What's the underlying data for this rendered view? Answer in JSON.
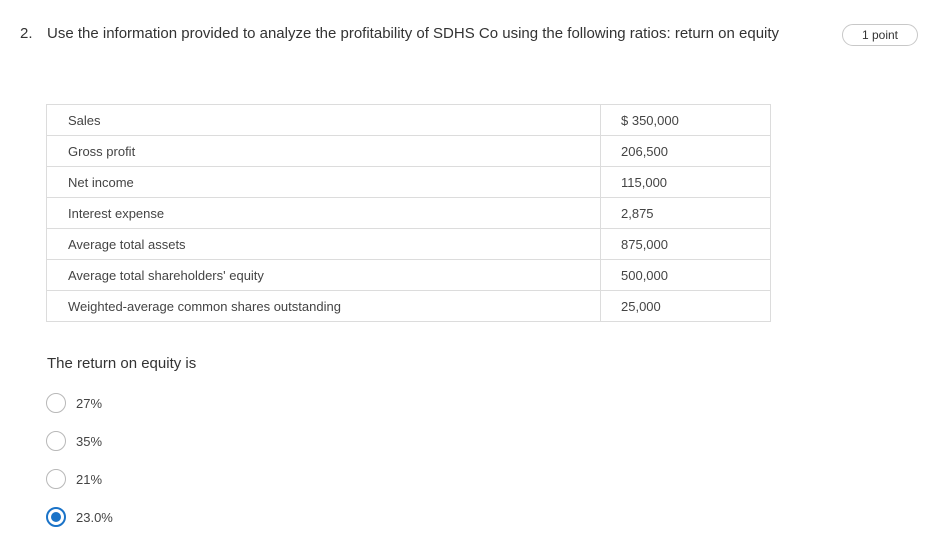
{
  "question": {
    "number": "2.",
    "text": "Use the information provided to analyze the profitability of SDHS Co using the following ratios: return on equity",
    "points": "1 point"
  },
  "table": {
    "rows": [
      {
        "label": "Sales",
        "value": "$ 350,000"
      },
      {
        "label": "Gross profit",
        "value": "206,500"
      },
      {
        "label": "Net income",
        "value": "115,000"
      },
      {
        "label": "Interest expense",
        "value": "2,875"
      },
      {
        "label": "Average total assets",
        "value": "875,000"
      },
      {
        "label": "Average total shareholders' equity",
        "value": "500,000"
      },
      {
        "label": "Weighted-average common shares outstanding",
        "value": "25,000"
      }
    ]
  },
  "prompt": "The return on equity is",
  "options": [
    {
      "label": "27%",
      "selected": false
    },
    {
      "label": "35%",
      "selected": false
    },
    {
      "label": "21%",
      "selected": false
    },
    {
      "label": "23.0%",
      "selected": true
    }
  ],
  "colors": {
    "accent": "#1a73c8",
    "border": "#dcdcdc",
    "text": "#333333"
  }
}
